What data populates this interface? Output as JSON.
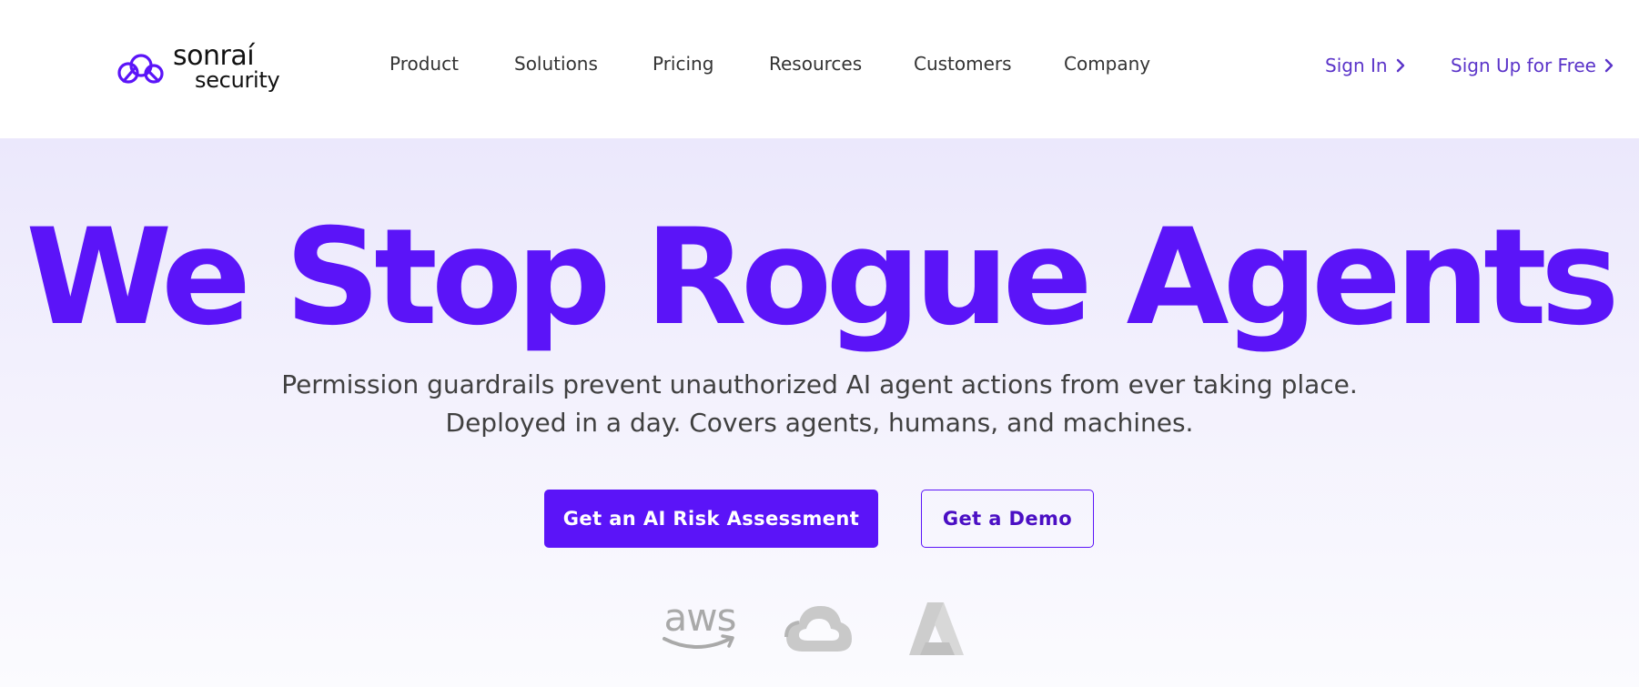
{
  "brand": {
    "name_line1": "sonraí",
    "name_line2": "security",
    "accent_color": "#5b14f8",
    "link_color": "#5b34c9"
  },
  "nav": {
    "items": [
      {
        "label": "Product"
      },
      {
        "label": "Solutions"
      },
      {
        "label": "Pricing"
      },
      {
        "label": "Resources"
      },
      {
        "label": "Customers"
      },
      {
        "label": "Company"
      }
    ],
    "sign_in": "Sign In",
    "sign_up": "Sign Up for Free"
  },
  "hero": {
    "title": "We Stop Rogue Agents",
    "subtitle_line1": "Permission guardrails prevent unauthorized AI agent actions from ever taking place.",
    "subtitle_line2": "Deployed in a day. Covers agents, humans, and machines.",
    "primary_cta": "Get an AI Risk Assessment",
    "secondary_cta": "Get a Demo"
  },
  "cloud_logos": {
    "aws_text": "aws",
    "icons": [
      "aws-logo-icon",
      "google-cloud-logo-icon",
      "azure-logo-icon"
    ]
  }
}
